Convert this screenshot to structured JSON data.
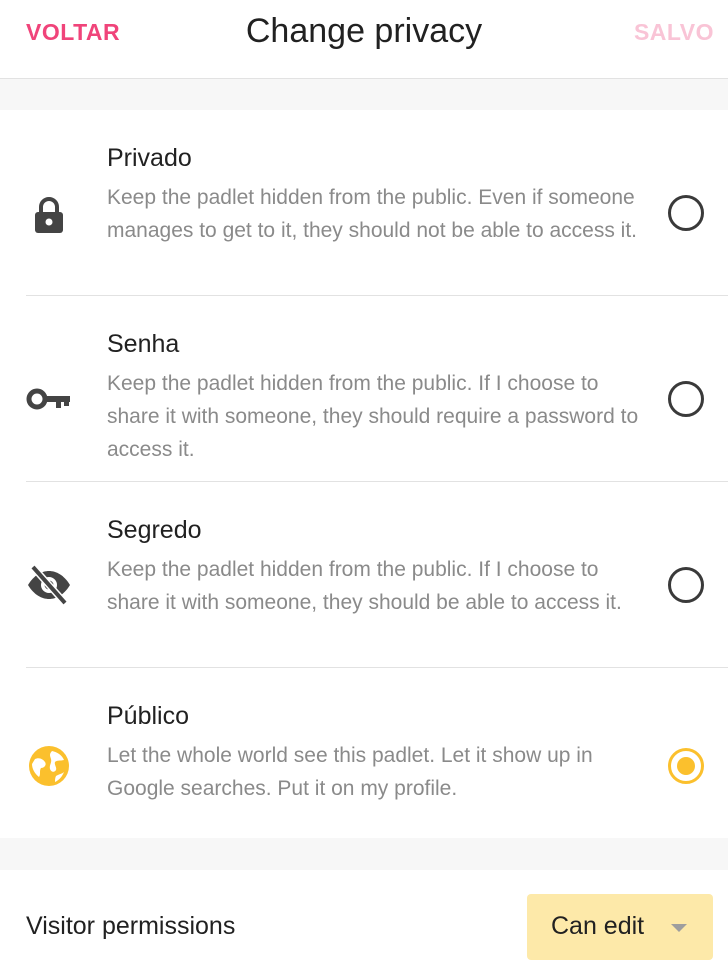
{
  "header": {
    "back_label": "VOLTAR",
    "title": "Change privacy",
    "save_label": "SALVO"
  },
  "privacy_options": [
    {
      "title": "Privado",
      "description": "Keep the padlet hidden from the public. Even if someone manages to get to it, they should not be able to access it.",
      "icon": "lock-icon",
      "selected": false
    },
    {
      "title": "Senha",
      "description": "Keep the padlet hidden from the public. If I choose to share it with someone, they should require a password to access it.",
      "icon": "key-icon",
      "selected": false
    },
    {
      "title": "Segredo",
      "description": "Keep the padlet hidden from the public. If I choose to share it with someone, they should be able to access it.",
      "icon": "eye-off-icon",
      "selected": false
    },
    {
      "title": "Público",
      "description": "Let the whole world see this padlet. Let it show up in Google searches. Put it on my profile.",
      "icon": "globe-icon",
      "selected": true
    }
  ],
  "visitor_permissions": {
    "label": "Visitor permissions",
    "value": "Can edit"
  },
  "colors": {
    "accent_pink": "#f0447a",
    "accent_pink_disabled": "#f9c4d6",
    "selected_yellow": "#fbc02d",
    "select_bg": "#fde9a9",
    "icon_gray": "#444444",
    "description_gray": "#8a8a8a"
  }
}
